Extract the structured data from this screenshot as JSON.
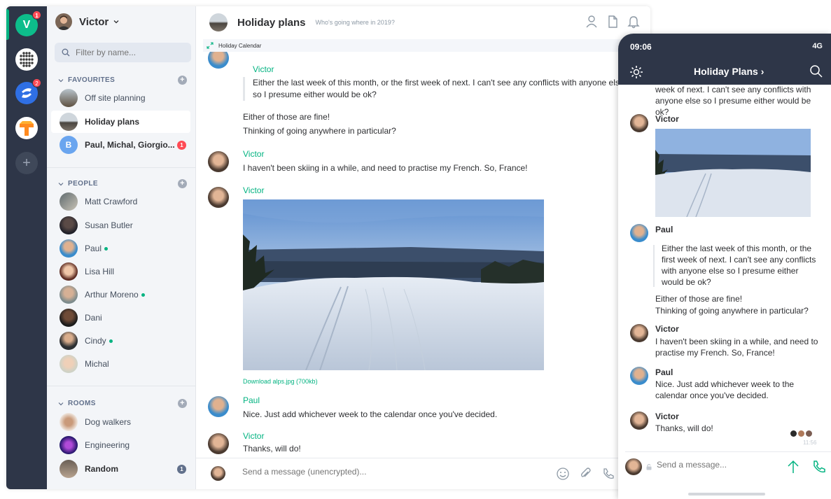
{
  "colors": {
    "accent": "#03b381",
    "sidebar_dark": "#2e3648",
    "badge_red": "#ff4b55",
    "badge_grey": "#61708b"
  },
  "spaces": [
    {
      "icon": "home-avatar-v",
      "letter": "V",
      "badge": "1"
    },
    {
      "icon": "dots-grid-icon"
    },
    {
      "icon": "blue-space-icon",
      "badge": "2"
    },
    {
      "icon": "orange-space-icon"
    },
    {
      "icon": "plus-icon",
      "symbol": "+"
    }
  ],
  "user": {
    "name": "Victor"
  },
  "filter": {
    "placeholder": "Filter by name..."
  },
  "sections": {
    "favourites": "FAVOURITES",
    "people": "PEOPLE",
    "rooms": "ROOMS"
  },
  "favourites": [
    {
      "name": "Off site planning"
    },
    {
      "name": "Holiday plans",
      "selected": true
    },
    {
      "name": "Paul, Michal, Giorgio...",
      "initial": "B",
      "badge": "1"
    }
  ],
  "people": [
    {
      "name": "Matt Crawford"
    },
    {
      "name": "Susan Butler"
    },
    {
      "name": "Paul",
      "online": true
    },
    {
      "name": "Lisa Hill"
    },
    {
      "name": "Arthur Moreno",
      "online": true
    },
    {
      "name": "Dani"
    },
    {
      "name": "Cindy",
      "online": true
    },
    {
      "name": "Michal"
    }
  ],
  "rooms": [
    {
      "name": "Dog walkers"
    },
    {
      "name": "Engineering"
    },
    {
      "name": "Random",
      "badge": "1"
    }
  ],
  "room": {
    "title": "Holiday plans",
    "topic": "Who's going where in 2019?",
    "widget": "Holiday Calendar"
  },
  "messages": {
    "m1_sender": "Victor",
    "m1_quote": "Either the last week of this month, or the first week of next. I can't see any conflicts with anyone else so I presume either would be ok?",
    "m1_reply_1": "Either of those are fine!",
    "m1_reply_2": "Thinking of going anywhere in particular?",
    "m2_sender": "Victor",
    "m2_text": "I haven't been skiing in a while, and need to practise my French. So, France!",
    "m3_sender": "Victor",
    "m3_download": "Download alps.jpg (700kb)",
    "m4_sender": "Paul",
    "m4_text": "Nice. Just add whichever week to the calendar once you've decided.",
    "m5_sender": "Victor",
    "m5_text": "Thanks, will do!"
  },
  "composer": {
    "placeholder": "Send a message (unencrypted)..."
  },
  "phone": {
    "time": "09:06",
    "network": "4G",
    "title": "Holiday Plans",
    "top_text": "week of next. I can't see any conflicts with anyone else so I presume either would be ok?",
    "p1_name": "Victor",
    "p2_name": "Paul",
    "p2_quote": "Either the last week of this month, or the first week of next. I can't see any conflicts with anyone else so I presume either would be ok?",
    "p2_reply_1": "Either of those are fine!",
    "p2_reply_2": "Thinking of going anywhere in particular?",
    "p3_name": "Victor",
    "p3_text": "I haven't been skiing in a while, and need to practise my French. So, France!",
    "p4_name": "Paul",
    "p4_text": "Nice. Just add whichever week to the calendar once you've decided.",
    "p5_name": "Victor",
    "p5_text": "Thanks, will do!",
    "p5_time": "11:56",
    "composer_placeholder": "Send a message..."
  }
}
